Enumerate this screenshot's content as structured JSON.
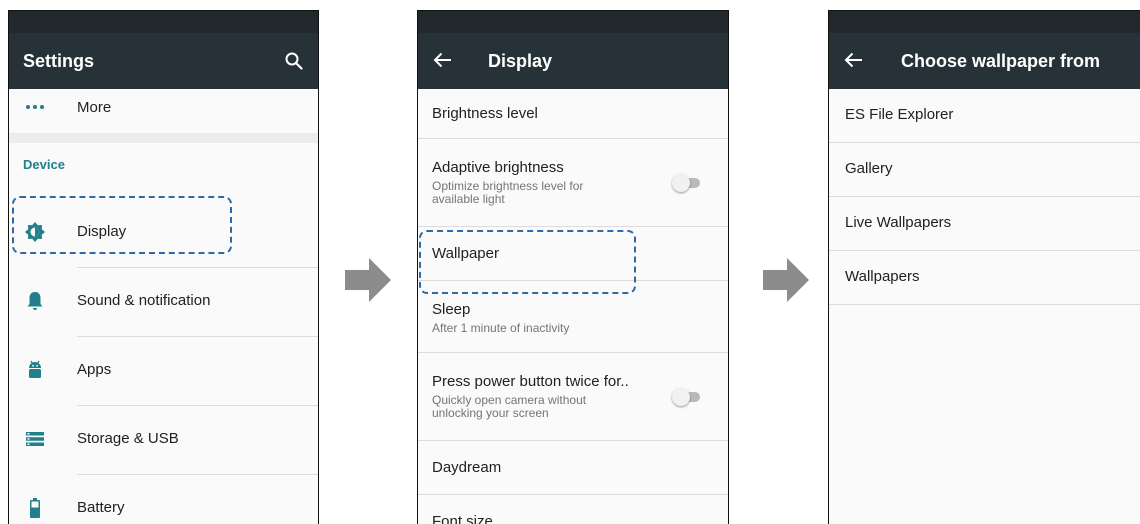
{
  "settings": {
    "title": "Settings",
    "items_top": [
      {
        "label": "More",
        "icon": "more-dots-icon"
      }
    ],
    "section_label": "Device",
    "items": [
      {
        "label": "Display",
        "icon": "brightness-icon"
      },
      {
        "label": "Sound & notification",
        "icon": "bell-icon"
      },
      {
        "label": "Apps",
        "icon": "android-icon"
      },
      {
        "label": "Storage & USB",
        "icon": "storage-icon"
      },
      {
        "label": "Battery",
        "icon": "battery-icon"
      }
    ]
  },
  "display": {
    "title": "Display",
    "items": [
      {
        "title": "Brightness level"
      },
      {
        "title": "Adaptive brightness",
        "subtitle": "Optimize brightness level for available light",
        "toggle": false
      },
      {
        "title": "Wallpaper"
      },
      {
        "title": "Sleep",
        "subtitle": "After 1 minute of inactivity"
      },
      {
        "title": "Press power button twice for..",
        "subtitle": "Quickly open camera without unlocking your screen",
        "toggle": false
      },
      {
        "title": "Daydream"
      },
      {
        "title": "Font size"
      }
    ]
  },
  "chooser": {
    "title": "Choose wallpaper from",
    "items": [
      "ES File Explorer",
      "Gallery",
      "Live Wallpapers",
      "Wallpapers"
    ]
  },
  "colors": {
    "toolbar": "#263238",
    "statusbar": "#22292c",
    "accent": "#22808a",
    "highlight": "#2e6aa3",
    "arrow": "#8c8c8c"
  }
}
